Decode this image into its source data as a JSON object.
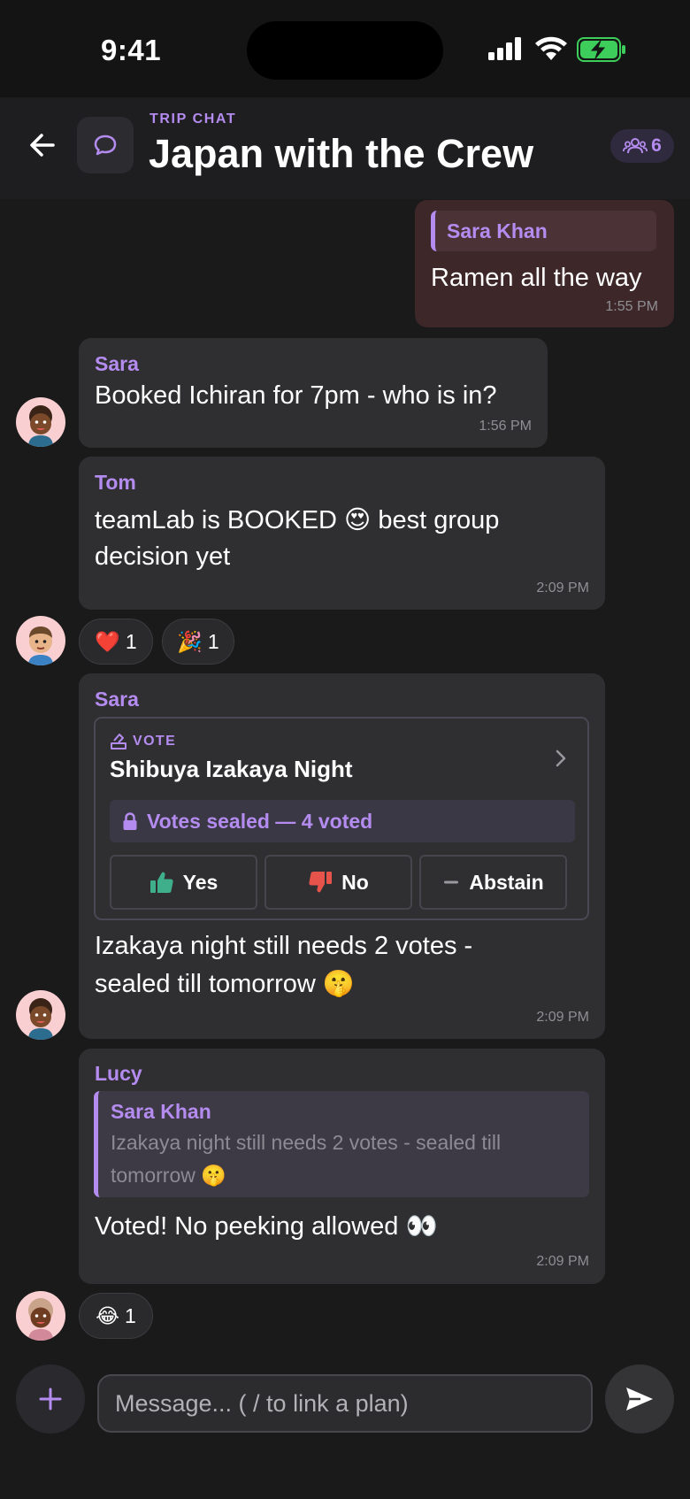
{
  "status_bar": {
    "time": "9:41"
  },
  "header": {
    "kicker": "TRIP CHAT",
    "title": "Japan with the Crew",
    "member_count": "6",
    "icons": {
      "back": "arrow-left-icon",
      "chat": "chat-bubble-icon",
      "members": "people-icon"
    }
  },
  "colors": {
    "accent": "#b48cf0",
    "background": "#1a1a1b",
    "bubble": "#2f2f31",
    "own_bubble": "#3d2729",
    "thumb_up": "#3fae8a",
    "thumb_down": "#e5534b"
  },
  "messages": [
    {
      "sender": "",
      "own": true,
      "quote": {
        "author": "Sara Khan"
      },
      "text": "Ramen all the way",
      "time": "1:55 PM"
    },
    {
      "sender": "Sara",
      "text": "Booked Ichiran for 7pm - who is in?",
      "time": "1:56 PM"
    },
    {
      "sender": "Tom",
      "text_lines": [
        "teamLab is BOOKED 😍 best group",
        "decision yet"
      ],
      "time": "2:09 PM",
      "reactions": [
        {
          "emoji": "❤️",
          "count": "1"
        },
        {
          "emoji": "🎉",
          "count": "1"
        }
      ]
    },
    {
      "sender": "Sara",
      "vote": {
        "kicker": "VOTE",
        "title": "Shibuya Izakaya Night",
        "status": "Votes sealed — 4 voted",
        "options": [
          "Yes",
          "No",
          "Abstain"
        ]
      },
      "text_lines": [
        "Izakaya night still needs 2 votes -",
        "sealed till tomorrow 🤫"
      ],
      "time": "2:09 PM"
    },
    {
      "sender": "Lucy",
      "quote": {
        "author": "Sara Khan",
        "text_lines": [
          "Izakaya night still needs 2 votes - sealed till",
          "tomorrow 🤫"
        ]
      },
      "text": "Voted! No peeking allowed 👀",
      "time": "2:09 PM",
      "reactions": [
        {
          "emoji": "😂",
          "count": "1"
        }
      ]
    }
  ],
  "composer": {
    "placeholder": "Message... ( / to link a plan)",
    "value": ""
  }
}
